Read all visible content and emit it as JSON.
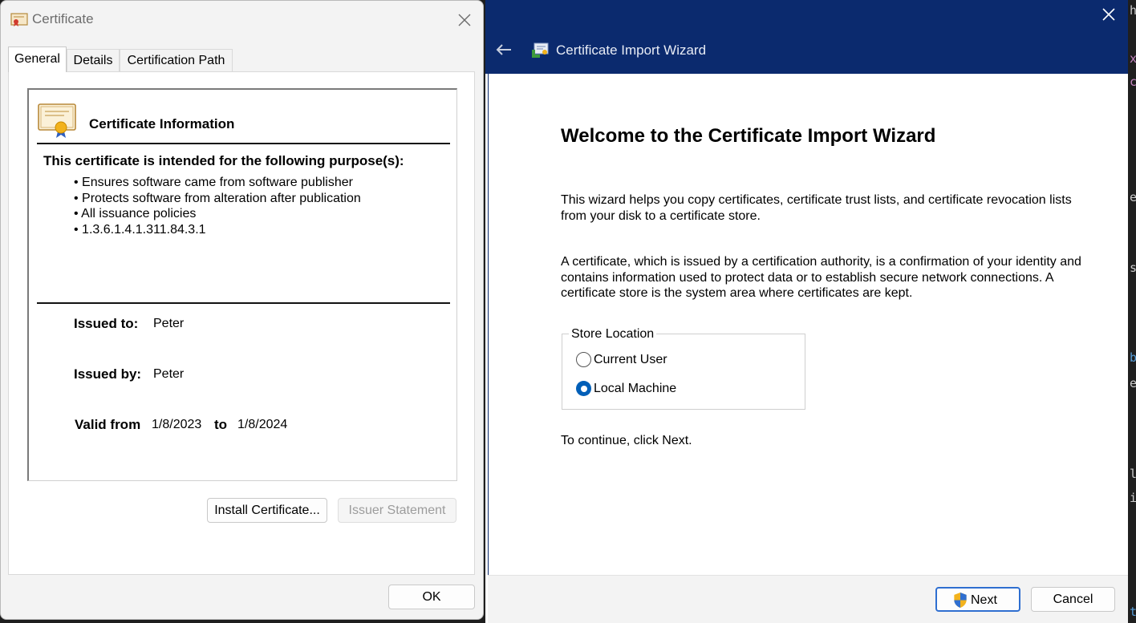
{
  "cert_dialog": {
    "title": "Certificate",
    "tabs": [
      {
        "label": "General",
        "active": true
      },
      {
        "label": "Details",
        "active": false
      },
      {
        "label": "Certification Path",
        "active": false
      }
    ],
    "info_heading": "Certificate Information",
    "purpose_heading": "This certificate is intended for the following purpose(s):",
    "purposes": [
      "Ensures software came from software publisher",
      "Protects software from alteration after publication",
      "All issuance policies",
      "1.3.6.1.4.1.311.84.3.1"
    ],
    "issued_to_label": "Issued to:",
    "issued_to": "Peter",
    "issued_by_label": "Issued by:",
    "issued_by": "Peter",
    "valid_from_label": "Valid from",
    "valid_from": "1/8/2023",
    "to_label": "to",
    "valid_to": "1/8/2024",
    "install_button": "Install Certificate...",
    "issuer_statement_button": "Issuer Statement",
    "ok_button": "OK"
  },
  "wizard": {
    "title": "Certificate Import Wizard",
    "heading": "Welcome to the Certificate Import Wizard",
    "intro": "This wizard helps you copy certificates, certificate trust lists, and certificate revocation lists from your disk to a certificate store.",
    "description": "A certificate, which is issued by a certification authority, is a confirmation of your identity and contains information used to protect data or to establish secure network connections. A certificate store is the system area where certificates are kept.",
    "store_location_legend": "Store Location",
    "options": [
      {
        "label": "Current User",
        "selected": false
      },
      {
        "label": "Local Machine",
        "selected": true
      }
    ],
    "continue_text": "To continue, click Next.",
    "next_button": "Next",
    "cancel_button": "Cancel"
  },
  "background_editor": {
    "chars": [
      "h",
      "x",
      "c",
      "e",
      "s",
      "b",
      "e",
      "l",
      "i",
      "t"
    ]
  },
  "colors": {
    "wizard_header": "#0b2a6e",
    "radio_selected": "#005fb8",
    "next_focus": "#2f6fd0"
  }
}
